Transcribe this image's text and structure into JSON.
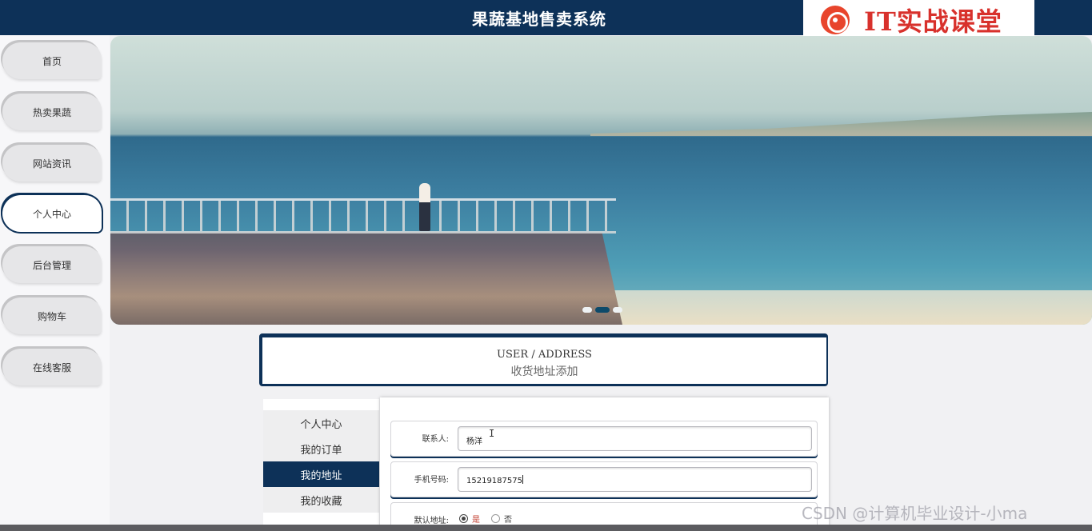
{
  "header": {
    "title": "果蔬基地售卖系统"
  },
  "logo": {
    "text": "IT实战课堂"
  },
  "sidebar": {
    "items": [
      {
        "label": "首页",
        "active": false
      },
      {
        "label": "热卖果蔬",
        "active": false
      },
      {
        "label": "网站资讯",
        "active": false
      },
      {
        "label": "个人中心",
        "active": true
      },
      {
        "label": "后台管理",
        "active": false
      },
      {
        "label": "购物车",
        "active": false
      },
      {
        "label": "在线客服",
        "active": false
      }
    ]
  },
  "section": {
    "title_en": "USER / ADDRESS",
    "title_cn": "收货地址添加"
  },
  "user_menu": {
    "items": [
      {
        "label": "个人中心",
        "active": false
      },
      {
        "label": "我的订单",
        "active": false
      },
      {
        "label": "我的地址",
        "active": true
      },
      {
        "label": "我的收藏",
        "active": false
      }
    ]
  },
  "form": {
    "contact_label": "联系人:",
    "contact_value": "杨洋",
    "phone_label": "手机号码:",
    "phone_value": "15219187575",
    "default_label": "默认地址:",
    "default_options": [
      "是",
      "否"
    ],
    "default_selected": "是"
  },
  "watermark": "CSDN @计算机毕业设计-小ma",
  "colors": {
    "primary": "#0d3158",
    "logo_red": "#d8312c"
  }
}
